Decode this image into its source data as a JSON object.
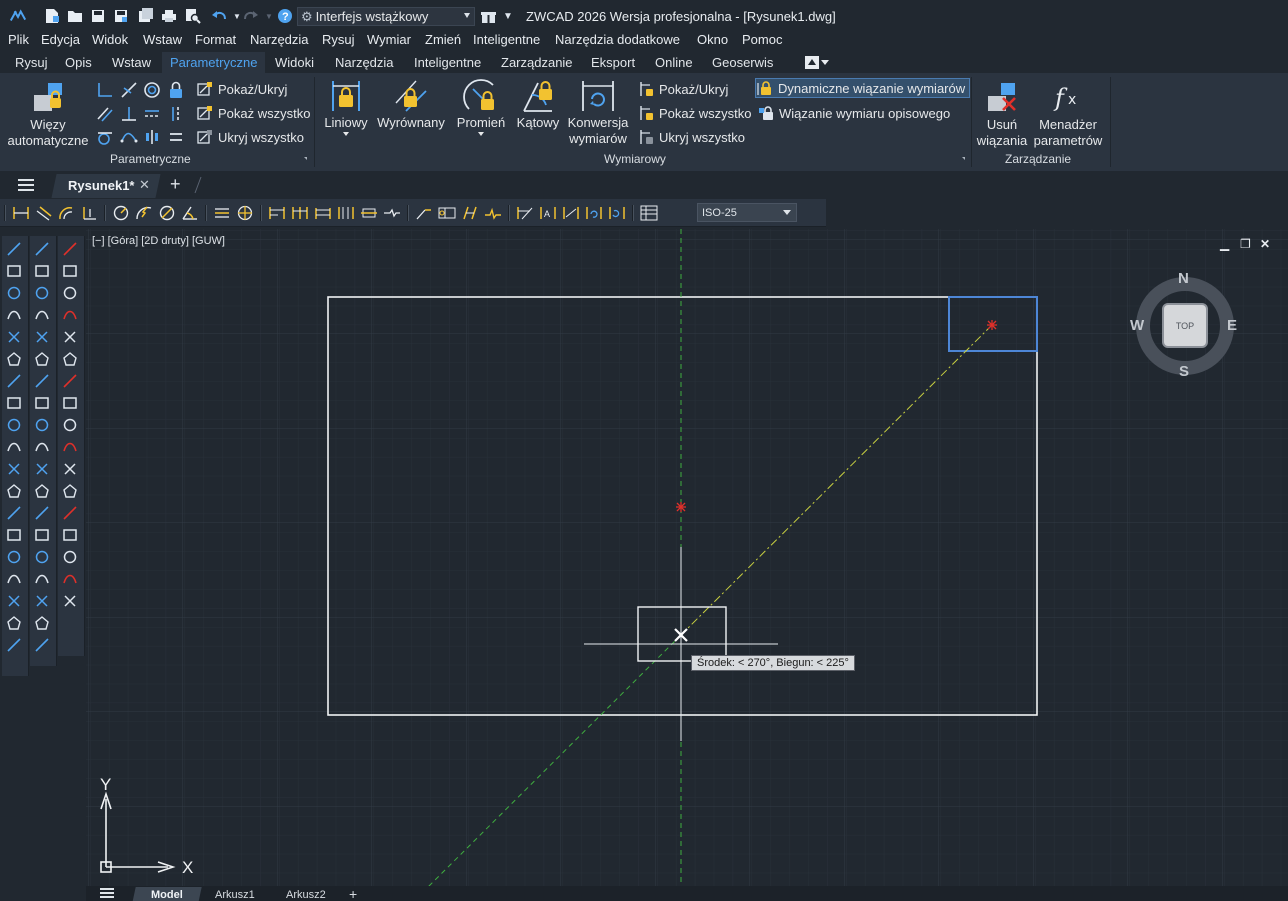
{
  "app": {
    "title": "ZWCAD 2026 Wersja profesjonalna - [Rysunek1.dwg]",
    "workspace": "Interfejs wstążkowy"
  },
  "menu": [
    "Plik",
    "Edycja",
    "Widok",
    "Wstaw",
    "Format",
    "Narzędzia",
    "Rysuj",
    "Wymiar",
    "Zmień",
    "Inteligentne",
    "Narzędzia dodatkowe",
    "Okno",
    "Pomoc"
  ],
  "ribbon_tabs": [
    "Rysuj",
    "Opis",
    "Wstaw",
    "Parametryczne",
    "Widoki",
    "Narzędzia",
    "Inteligentne",
    "Zarządzanie",
    "Eksport",
    "Online",
    "Geoserwis"
  ],
  "ribbon_active_tab": "Parametryczne",
  "ribbon": {
    "parametryczne": {
      "title": "Parametryczne",
      "auto_line1": "Więzy",
      "auto_line2": "automatyczne",
      "show_hide": "Pokaż/Ukryj",
      "show_all": "Pokaż wszystko",
      "hide_all": "Ukryj wszystko"
    },
    "wymiarowy": {
      "title": "Wymiarowy",
      "liniowy": "Liniowy",
      "wyrownany": "Wyrównany",
      "promien": "Promień",
      "katowy": "Kątowy",
      "konwersja_line1": "Konwersja",
      "konwersja_line2": "wymiarów",
      "show_hide": "Pokaż/Ukryj",
      "show_all": "Pokaż wszystko",
      "hide_all": "Ukryj wszystko",
      "dynamic": "Dynamiczne wiązanie wymiarów",
      "annotative": "Wiązanie wymiaru opisowego"
    },
    "zarzadzanie": {
      "title": "Zarządzanie",
      "usun_line1": "Usuń",
      "usun_line2": "wiązania",
      "menadzer_line1": "Menadżer",
      "menadzer_line2": "parametrów"
    }
  },
  "document": {
    "tab_label": "Rysunek1*"
  },
  "dim_toolbar": {
    "style": "ISO-25"
  },
  "viewport": {
    "label": "[−] [Góra] [2D druty] [GUW]",
    "viewcube_top": "TOP",
    "compass": {
      "n": "N",
      "s": "S",
      "e": "E",
      "w": "W"
    },
    "ucs_x": "X",
    "ucs_y": "Y"
  },
  "tooltip": "Środek: < 270°,  Biegun: < 225°",
  "layout_tabs": [
    "Model",
    "Arkusz1",
    "Arkusz2"
  ],
  "colors": {
    "accent": "#4fa3f0",
    "canvas": "#212830",
    "panel": "#2b3440",
    "crosshair_green": "#3fae3f",
    "trace_yellow": "#c8d040",
    "marker_red": "#e0302a",
    "selection_blue": "#4d86d6"
  }
}
